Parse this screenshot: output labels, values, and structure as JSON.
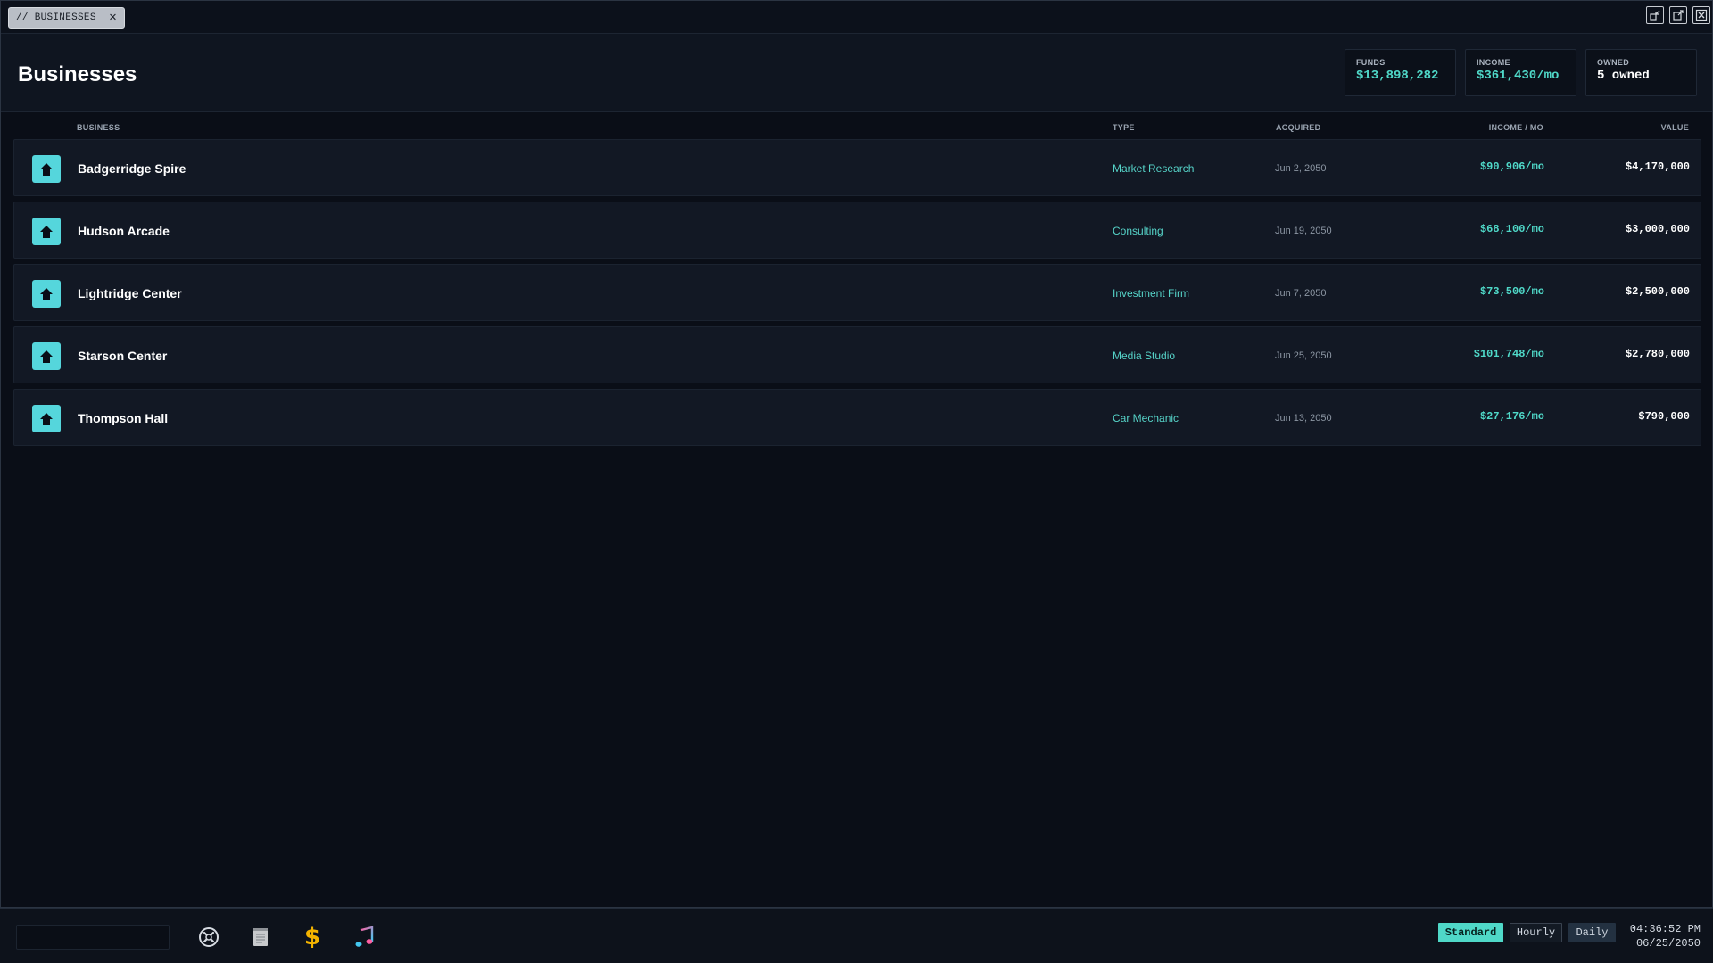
{
  "tab": {
    "label": "// BUSINESSES",
    "close": "✕"
  },
  "header": {
    "title": "Businesses"
  },
  "stats": [
    {
      "label": "FUNDS",
      "value": "$13,898,282"
    },
    {
      "label": "INCOME",
      "value": "$361,430/mo"
    },
    {
      "label": "OWNED",
      "value": "5 owned"
    }
  ],
  "columns": {
    "business": "BUSINESS",
    "type": "TYPE",
    "acquired": "ACQUIRED",
    "income": "INCOME / MO",
    "value": "VALUE"
  },
  "rows": [
    {
      "name": "Badgerridge Spire",
      "type": "Market Research",
      "acquired": "Jun 2, 2050",
      "income": "$90,906/mo",
      "value": "$4,170,000",
      "icon": "house-icon"
    },
    {
      "name": "Hudson Arcade",
      "type": "Consulting",
      "acquired": "Jun 19, 2050",
      "income": "$68,100/mo",
      "value": "$3,000,000",
      "icon": "house-icon"
    },
    {
      "name": "Lightridge Center",
      "type": "Investment Firm",
      "acquired": "Jun 7, 2050",
      "income": "$73,500/mo",
      "value": "$2,500,000",
      "icon": "house-icon"
    },
    {
      "name": "Starson Center",
      "type": "Media Studio",
      "acquired": "Jun 25, 2050",
      "income": "$101,748/mo",
      "value": "$2,780,000",
      "icon": "house-icon"
    },
    {
      "name": "Thompson Hall",
      "type": "Car Mechanic",
      "acquired": "Jun 13, 2050",
      "income": "$27,176/mo",
      "value": "$790,000",
      "icon": "house-icon"
    }
  ],
  "taskbar": {
    "apps": [
      "wrench-screwdriver-icon",
      "notepad-icon",
      "dollar-icon",
      "music-note-icon"
    ],
    "dollar_glyph": "$",
    "speeds": {
      "standard": "Standard",
      "hourly": "Hourly",
      "daily": "Daily",
      "active": "Standard"
    },
    "time": "04:36:52 PM",
    "date": "06/25/2050"
  },
  "colors": {
    "accent": "#4fd8c8",
    "icon_bg": "#55d6dc",
    "background": "#0a0e17",
    "row_bg": "#121824"
  }
}
